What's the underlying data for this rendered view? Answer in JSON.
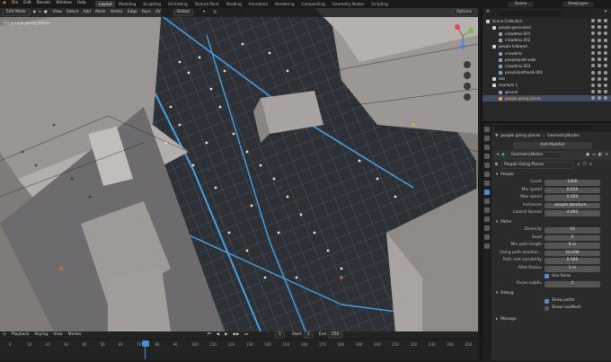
{
  "menubar": {
    "items": [
      "File",
      "Edit",
      "Render",
      "Window",
      "Help"
    ],
    "workspace_tabs": [
      "Layout",
      "Modeling",
      "Sculpting",
      "UV Editing",
      "Texture Paint",
      "Shading",
      "Animation",
      "Rendering",
      "Compositing",
      "Geometry Nodes",
      "Scripting"
    ],
    "active_tab": "Layout",
    "scene": "Scene",
    "view_layer": "ViewLayer"
  },
  "viewport_header": {
    "mode": "Edit Mode",
    "menus": [
      "View",
      "Select",
      "Add",
      "Mesh",
      "Vertex",
      "Edge",
      "Face",
      "UV"
    ],
    "transform": "Global",
    "options": "Options",
    "overlay_text": "(1) people going places"
  },
  "timeline": {
    "menus": [
      "Playback",
      "Keying",
      "View",
      "Marker"
    ],
    "current_frame": "1",
    "start_label": "Start",
    "start": "1",
    "end_label": "End",
    "end": "250",
    "ticks": [
      "0",
      "10",
      "20",
      "30",
      "40",
      "50",
      "60",
      "70",
      "80",
      "90",
      "100",
      "110",
      "120",
      "130",
      "140",
      "150",
      "160",
      "170",
      "180",
      "190",
      "200",
      "210",
      "220",
      "230",
      "240",
      "250"
    ]
  },
  "outliner": {
    "rows": [
      {
        "label": "Scene Collection",
        "indent": 0,
        "color": "#cfcfcf",
        "sel": false
      },
      {
        "label": "people-generated",
        "indent": 1,
        "color": "#cfcfcf",
        "sel": false
      },
      {
        "label": "crowdmix.001",
        "indent": 2,
        "color": "#cfcfcf",
        "sel": false
      },
      {
        "label": "crowdmix.002",
        "indent": 2,
        "color": "#cfcfcf",
        "sel": false
      },
      {
        "label": "people followed",
        "indent": 1,
        "color": "#cfcfcf",
        "sel": false
      },
      {
        "label": "crowdmix",
        "indent": 2,
        "color": "#cfcfcf",
        "sel": false
      },
      {
        "label": "people/path-walk",
        "indent": 2,
        "color": "#cfcfcf",
        "sel": false
      },
      {
        "label": "crowdmix.003",
        "indent": 2,
        "color": "#cfcfcf",
        "sel": false
      },
      {
        "label": "people/pathwalk.001",
        "indent": 2,
        "color": "#cfcfcf",
        "sel": false
      },
      {
        "label": "lots",
        "indent": 1,
        "color": "#cfcfcf",
        "sel": false
      },
      {
        "label": "example 1",
        "indent": 1,
        "color": "#cfcfcf",
        "sel": false
      },
      {
        "label": "ground",
        "indent": 2,
        "color": "#cfcfcf",
        "sel": false
      },
      {
        "label": "people going places",
        "indent": 2,
        "color": "#ffb24a",
        "sel": true
      }
    ]
  },
  "properties": {
    "object_name": "people going places",
    "modifier_tab": "GeometryNodes",
    "add_modifier": "Add Modifier",
    "modifier_name": "GeometryNodes",
    "node_group": "People Going Places",
    "panels": {
      "people": "People",
      "paths": "Paths",
      "debug": "Debug",
      "manage": "Manage"
    },
    "people_fields": [
      {
        "label": "Count",
        "value": "1000"
      },
      {
        "label": "Min speed",
        "value": "0.010"
      },
      {
        "label": "Max speed",
        "value": "0.050"
      },
      {
        "label": "Instances",
        "value": "people.tpeoture..."
      },
      {
        "label": "Lateral Spread",
        "value": "4.000"
      }
    ],
    "paths_fields": [
      {
        "label": "Diversity",
        "value": "14"
      },
      {
        "label": "Seed",
        "value": "0"
      },
      {
        "label": "Min path length",
        "value": "8 m"
      },
      {
        "label": "Using path avoidan...",
        "value": "10.000"
      },
      {
        "label": "Path cost variability",
        "value": "0.500"
      },
      {
        "label": "Fillet Radius",
        "value": "1 m"
      }
    ],
    "use_faces": "Use faces",
    "faces_subdiv_label": "Faces subdiv",
    "faces_subdiv": "1",
    "show_paths": "Show paths",
    "show_navmesh": "Show navMesh"
  },
  "colors": {
    "accent": "#4d8fd6",
    "selected_object": "#ffb24a",
    "grid": "#5fb7ff",
    "header_bg": "#1d1d1d"
  }
}
